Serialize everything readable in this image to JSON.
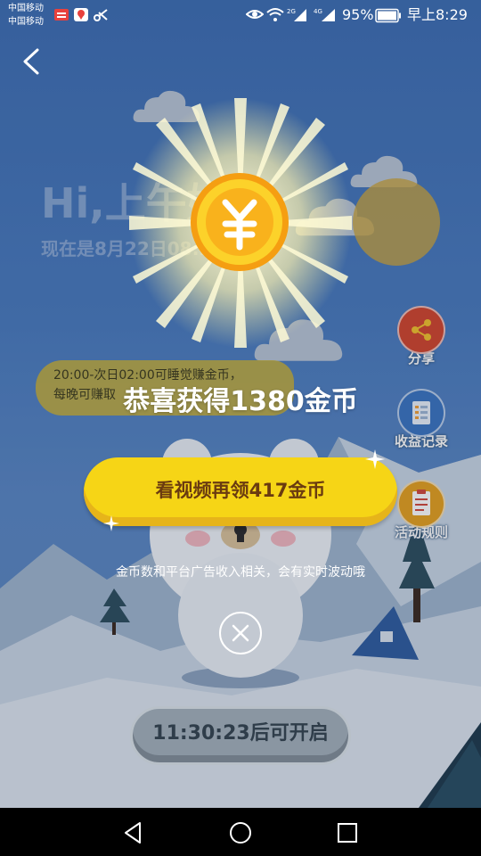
{
  "status_bar": {
    "carrier_1": "中国移动",
    "carrier_2": "中国移动",
    "battery": "95%",
    "time": "早上8:29",
    "icons": [
      "app-badge-icon",
      "map-pin-icon",
      "scissor-icon",
      "eye-icon",
      "wifi-icon",
      "signal-2g-icon",
      "signal-4g-icon",
      "battery-icon"
    ]
  },
  "header": {
    "greeting": "Hi,上午好",
    "current_time": "现在是8月22日08:29"
  },
  "tip": {
    "line1": "20:00-次日02:00可睡觉赚金币，",
    "line2": "每晚可赚取"
  },
  "side_menu": {
    "share": "分享",
    "earnings": "收益记录",
    "rules": "活动规则"
  },
  "reward": {
    "title": "恭喜获得1380金币",
    "video_button": "看视频再领417金币",
    "note": "金币数和平台广告收入相关，会有实时波动哦"
  },
  "timer": {
    "label": "11:30:23后可开启"
  },
  "colors": {
    "bg": "#4a7cbf",
    "button_yellow": "#f6d516",
    "coin_gold": "#f7b317",
    "button_text": "#6a3b10"
  }
}
